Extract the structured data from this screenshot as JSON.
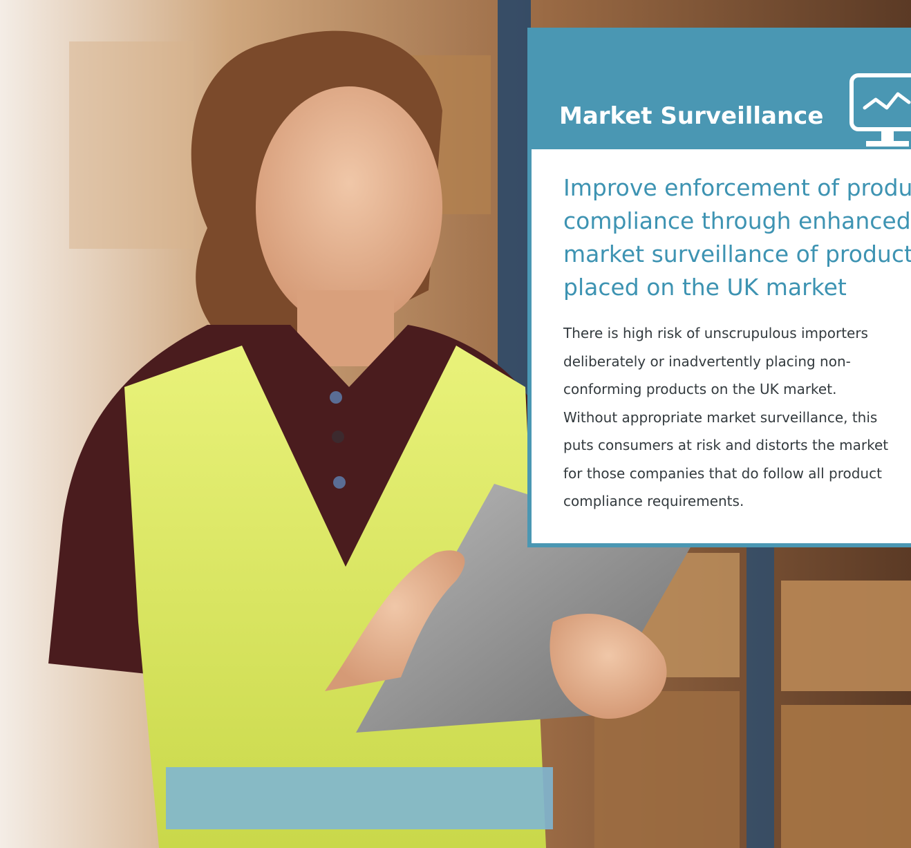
{
  "card": {
    "title": "Market Surveillance",
    "icon": "monitor-chart-icon",
    "headline_lines": [
      "Improve enforcement of product",
      "compliance through enhanced",
      "market surveillance of products",
      "placed on the UK market"
    ],
    "body_lines": [
      "There is high risk of unscrupulous importers",
      "deliberately or inadvertently placing non-",
      "conforming products on the UK market.",
      "Without appropriate market surveillance, this",
      "puts consumers at risk and distorts the market",
      "for those companies that do follow all product",
      "compliance requirements."
    ]
  },
  "colors": {
    "accent": "#4a97b3",
    "headline": "#3d93b2",
    "body_text": "#333a3e"
  }
}
